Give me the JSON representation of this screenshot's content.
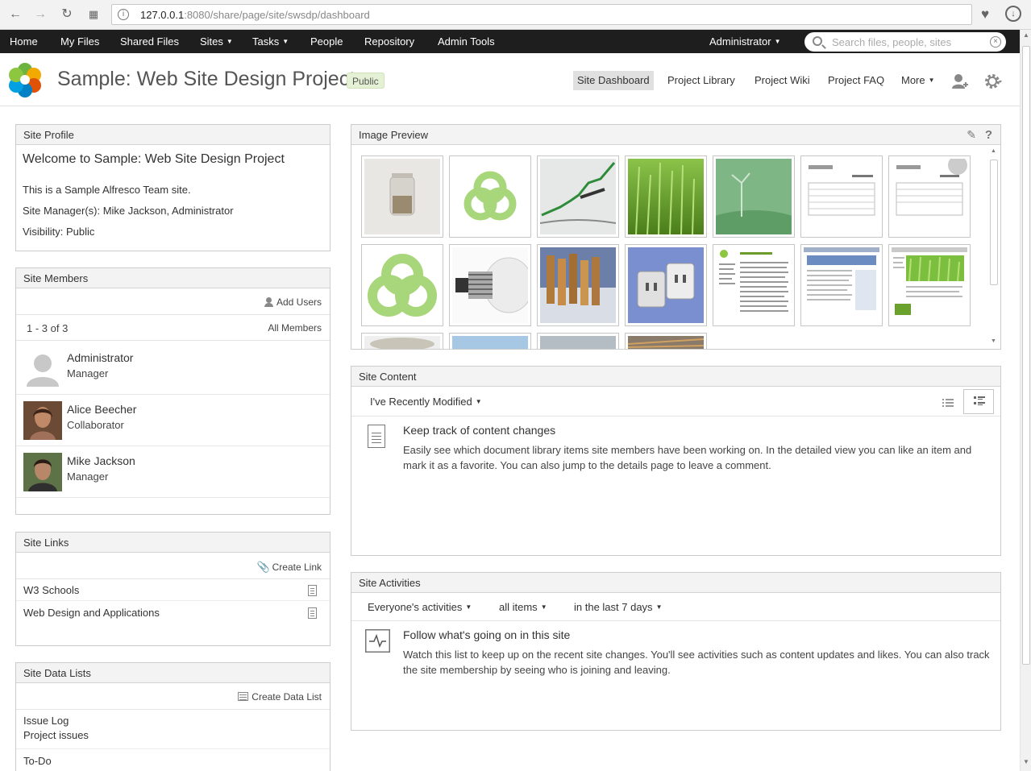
{
  "browser": {
    "url_host": "127.0.0.1",
    "url_rest": ":8080/share/page/site/swsdp/dashboard"
  },
  "app_nav": {
    "home": "Home",
    "my_files": "My Files",
    "shared_files": "Shared Files",
    "sites": "Sites",
    "tasks": "Tasks",
    "people": "People",
    "repository": "Repository",
    "admin_tools": "Admin Tools",
    "user": "Administrator",
    "search_placeholder": "Search files, people, sites"
  },
  "site": {
    "title": "Sample: Web Site Design Project",
    "visibility_badge": "Public",
    "nav": {
      "dashboard": "Site Dashboard",
      "library": "Project Library",
      "wiki": "Project Wiki",
      "faq": "Project FAQ",
      "more": "More"
    }
  },
  "site_profile": {
    "title": "Site Profile",
    "welcome": "Welcome to Sample: Web Site Design Project",
    "description": "This is a Sample Alfresco Team site.",
    "managers": "Site Manager(s): Mike Jackson, Administrator",
    "visibility": "Visibility: Public"
  },
  "site_members": {
    "title": "Site Members",
    "add_users": "Add Users",
    "count": "1 - 3 of 3",
    "all_members": "All Members",
    "members": [
      {
        "name": "Administrator",
        "role": "Manager"
      },
      {
        "name": "Alice Beecher",
        "role": "Collaborator"
      },
      {
        "name": "Mike Jackson",
        "role": "Manager"
      }
    ]
  },
  "site_links": {
    "title": "Site Links",
    "create_link": "Create Link",
    "links": [
      "W3 Schools",
      "Web Design and Applications"
    ]
  },
  "site_data_lists": {
    "title": "Site Data Lists",
    "create_list": "Create Data List",
    "lists": [
      {
        "name": "Issue Log",
        "description": "Project issues"
      },
      {
        "name": "To-Do",
        "description": ""
      }
    ]
  },
  "image_preview": {
    "title": "Image Preview"
  },
  "site_content": {
    "title": "Site Content",
    "filter": "I've Recently Modified",
    "empty_title": "Keep track of content changes",
    "empty_desc": "Easily see which document library items site members have been working on. In the detailed view you can like an item and mark it as a favorite. You can also jump to the details page to leave a comment."
  },
  "site_activities": {
    "title": "Site Activities",
    "filter_who": "Everyone's activities",
    "filter_what": "all items",
    "filter_when": "in the last 7 days",
    "empty_title": "Follow what's going on in this site",
    "empty_desc": "Watch this list to keep up on the recent site changes. You'll see activities such as content updates and likes. You can also track the site membership by seeing who is joining and leaving."
  }
}
